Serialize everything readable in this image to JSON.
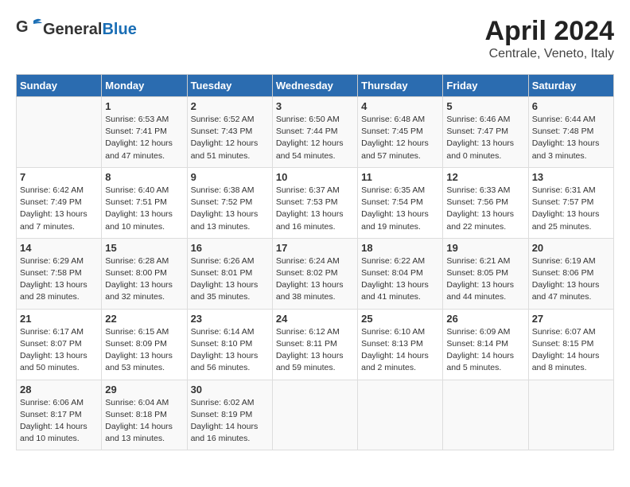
{
  "header": {
    "logo_general": "General",
    "logo_blue": "Blue",
    "title": "April 2024",
    "subtitle": "Centrale, Veneto, Italy"
  },
  "days": [
    "Sunday",
    "Monday",
    "Tuesday",
    "Wednesday",
    "Thursday",
    "Friday",
    "Saturday"
  ],
  "weeks": [
    [
      {
        "date": "",
        "sunrise": "",
        "sunset": "",
        "daylight": ""
      },
      {
        "date": "1",
        "sunrise": "Sunrise: 6:53 AM",
        "sunset": "Sunset: 7:41 PM",
        "daylight": "Daylight: 12 hours and 47 minutes."
      },
      {
        "date": "2",
        "sunrise": "Sunrise: 6:52 AM",
        "sunset": "Sunset: 7:43 PM",
        "daylight": "Daylight: 12 hours and 51 minutes."
      },
      {
        "date": "3",
        "sunrise": "Sunrise: 6:50 AM",
        "sunset": "Sunset: 7:44 PM",
        "daylight": "Daylight: 12 hours and 54 minutes."
      },
      {
        "date": "4",
        "sunrise": "Sunrise: 6:48 AM",
        "sunset": "Sunset: 7:45 PM",
        "daylight": "Daylight: 12 hours and 57 minutes."
      },
      {
        "date": "5",
        "sunrise": "Sunrise: 6:46 AM",
        "sunset": "Sunset: 7:47 PM",
        "daylight": "Daylight: 13 hours and 0 minutes."
      },
      {
        "date": "6",
        "sunrise": "Sunrise: 6:44 AM",
        "sunset": "Sunset: 7:48 PM",
        "daylight": "Daylight: 13 hours and 3 minutes."
      }
    ],
    [
      {
        "date": "7",
        "sunrise": "Sunrise: 6:42 AM",
        "sunset": "Sunset: 7:49 PM",
        "daylight": "Daylight: 13 hours and 7 minutes."
      },
      {
        "date": "8",
        "sunrise": "Sunrise: 6:40 AM",
        "sunset": "Sunset: 7:51 PM",
        "daylight": "Daylight: 13 hours and 10 minutes."
      },
      {
        "date": "9",
        "sunrise": "Sunrise: 6:38 AM",
        "sunset": "Sunset: 7:52 PM",
        "daylight": "Daylight: 13 hours and 13 minutes."
      },
      {
        "date": "10",
        "sunrise": "Sunrise: 6:37 AM",
        "sunset": "Sunset: 7:53 PM",
        "daylight": "Daylight: 13 hours and 16 minutes."
      },
      {
        "date": "11",
        "sunrise": "Sunrise: 6:35 AM",
        "sunset": "Sunset: 7:54 PM",
        "daylight": "Daylight: 13 hours and 19 minutes."
      },
      {
        "date": "12",
        "sunrise": "Sunrise: 6:33 AM",
        "sunset": "Sunset: 7:56 PM",
        "daylight": "Daylight: 13 hours and 22 minutes."
      },
      {
        "date": "13",
        "sunrise": "Sunrise: 6:31 AM",
        "sunset": "Sunset: 7:57 PM",
        "daylight": "Daylight: 13 hours and 25 minutes."
      }
    ],
    [
      {
        "date": "14",
        "sunrise": "Sunrise: 6:29 AM",
        "sunset": "Sunset: 7:58 PM",
        "daylight": "Daylight: 13 hours and 28 minutes."
      },
      {
        "date": "15",
        "sunrise": "Sunrise: 6:28 AM",
        "sunset": "Sunset: 8:00 PM",
        "daylight": "Daylight: 13 hours and 32 minutes."
      },
      {
        "date": "16",
        "sunrise": "Sunrise: 6:26 AM",
        "sunset": "Sunset: 8:01 PM",
        "daylight": "Daylight: 13 hours and 35 minutes."
      },
      {
        "date": "17",
        "sunrise": "Sunrise: 6:24 AM",
        "sunset": "Sunset: 8:02 PM",
        "daylight": "Daylight: 13 hours and 38 minutes."
      },
      {
        "date": "18",
        "sunrise": "Sunrise: 6:22 AM",
        "sunset": "Sunset: 8:04 PM",
        "daylight": "Daylight: 13 hours and 41 minutes."
      },
      {
        "date": "19",
        "sunrise": "Sunrise: 6:21 AM",
        "sunset": "Sunset: 8:05 PM",
        "daylight": "Daylight: 13 hours and 44 minutes."
      },
      {
        "date": "20",
        "sunrise": "Sunrise: 6:19 AM",
        "sunset": "Sunset: 8:06 PM",
        "daylight": "Daylight: 13 hours and 47 minutes."
      }
    ],
    [
      {
        "date": "21",
        "sunrise": "Sunrise: 6:17 AM",
        "sunset": "Sunset: 8:07 PM",
        "daylight": "Daylight: 13 hours and 50 minutes."
      },
      {
        "date": "22",
        "sunrise": "Sunrise: 6:15 AM",
        "sunset": "Sunset: 8:09 PM",
        "daylight": "Daylight: 13 hours and 53 minutes."
      },
      {
        "date": "23",
        "sunrise": "Sunrise: 6:14 AM",
        "sunset": "Sunset: 8:10 PM",
        "daylight": "Daylight: 13 hours and 56 minutes."
      },
      {
        "date": "24",
        "sunrise": "Sunrise: 6:12 AM",
        "sunset": "Sunset: 8:11 PM",
        "daylight": "Daylight: 13 hours and 59 minutes."
      },
      {
        "date": "25",
        "sunrise": "Sunrise: 6:10 AM",
        "sunset": "Sunset: 8:13 PM",
        "daylight": "Daylight: 14 hours and 2 minutes."
      },
      {
        "date": "26",
        "sunrise": "Sunrise: 6:09 AM",
        "sunset": "Sunset: 8:14 PM",
        "daylight": "Daylight: 14 hours and 5 minutes."
      },
      {
        "date": "27",
        "sunrise": "Sunrise: 6:07 AM",
        "sunset": "Sunset: 8:15 PM",
        "daylight": "Daylight: 14 hours and 8 minutes."
      }
    ],
    [
      {
        "date": "28",
        "sunrise": "Sunrise: 6:06 AM",
        "sunset": "Sunset: 8:17 PM",
        "daylight": "Daylight: 14 hours and 10 minutes."
      },
      {
        "date": "29",
        "sunrise": "Sunrise: 6:04 AM",
        "sunset": "Sunset: 8:18 PM",
        "daylight": "Daylight: 14 hours and 13 minutes."
      },
      {
        "date": "30",
        "sunrise": "Sunrise: 6:02 AM",
        "sunset": "Sunset: 8:19 PM",
        "daylight": "Daylight: 14 hours and 16 minutes."
      },
      {
        "date": "",
        "sunrise": "",
        "sunset": "",
        "daylight": ""
      },
      {
        "date": "",
        "sunrise": "",
        "sunset": "",
        "daylight": ""
      },
      {
        "date": "",
        "sunrise": "",
        "sunset": "",
        "daylight": ""
      },
      {
        "date": "",
        "sunrise": "",
        "sunset": "",
        "daylight": ""
      }
    ]
  ]
}
